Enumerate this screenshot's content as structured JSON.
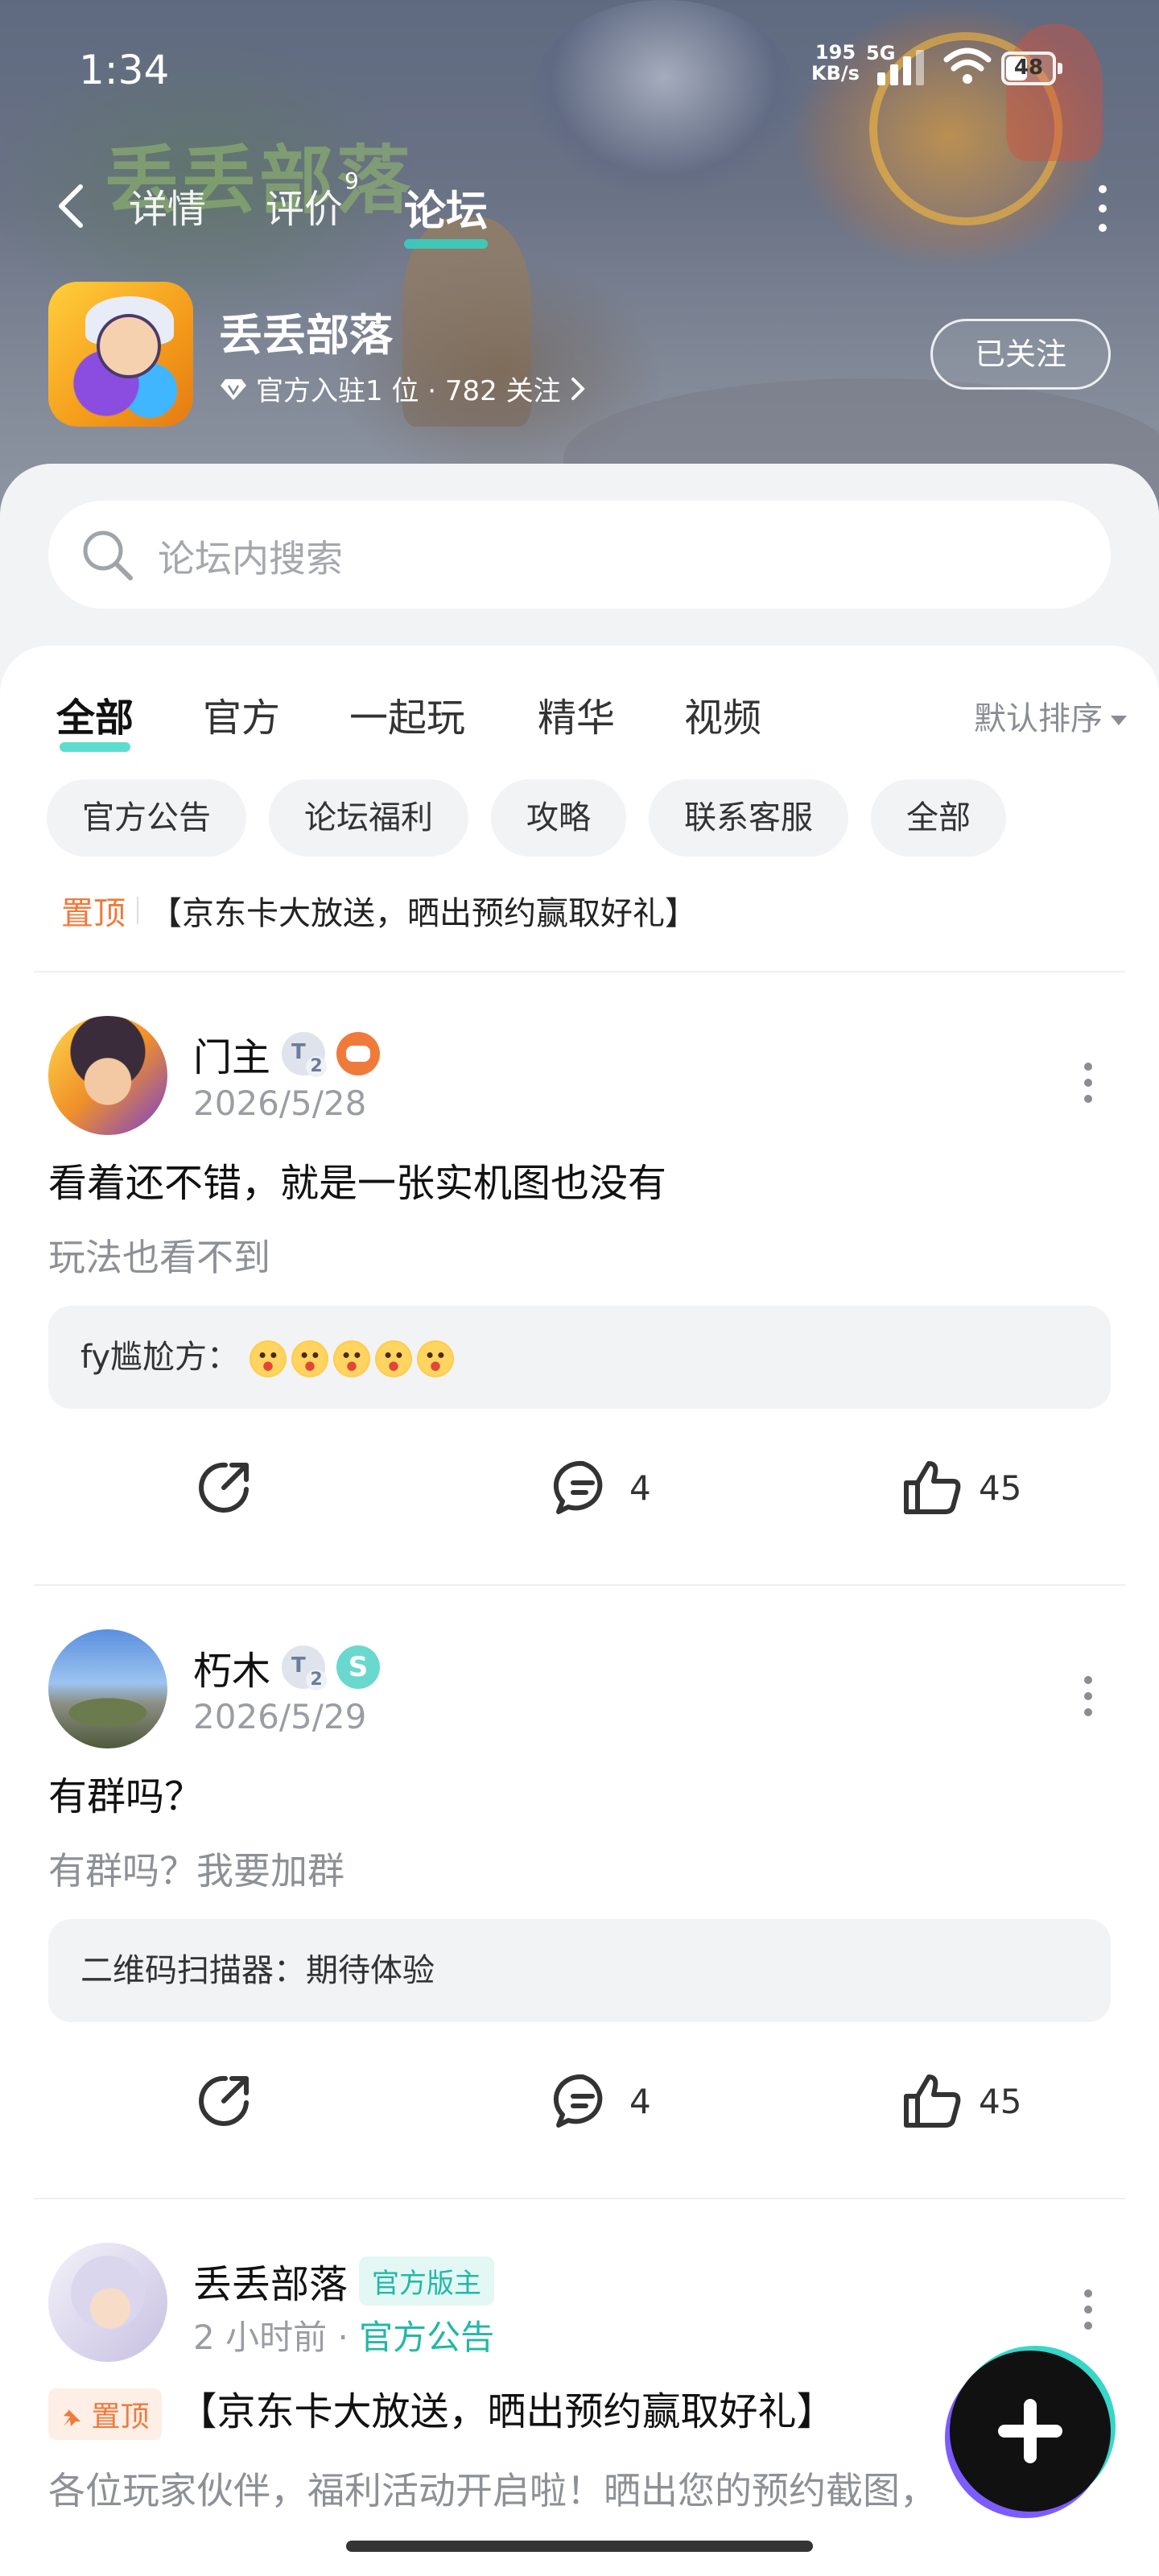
{
  "status_bar": {
    "time": "1:34",
    "net_speed": "195",
    "net_unit": "KB/s",
    "network": "5G",
    "battery": "48"
  },
  "nav": {
    "tabs": [
      {
        "label": "详情"
      },
      {
        "label": "评价"
      },
      {
        "label": "论坛"
      }
    ],
    "review_badge": "9",
    "active_tab": "论坛"
  },
  "game": {
    "name": "丢丢部落",
    "meta": "官方入驻1 位 · 782 关注",
    "follow_label": "已关注"
  },
  "search": {
    "placeholder": "论坛内搜索"
  },
  "filter_tabs": [
    {
      "label": "全部"
    },
    {
      "label": "官方"
    },
    {
      "label": "一起玩"
    },
    {
      "label": "精华"
    },
    {
      "label": "视频"
    }
  ],
  "sort_label": "默认排序",
  "chips": [
    "官方公告",
    "论坛福利",
    "攻略",
    "联系客服",
    "全部"
  ],
  "pinned_bar": {
    "tag": "置顶",
    "text": "【京东卡大放送，晒出预约赢取好礼】"
  },
  "posts": [
    {
      "user": "门主",
      "level": "2",
      "date": "2026/5/28",
      "title": "看着还不错，就是一张实机图也没有",
      "body": "玩法也看不到",
      "comment_user": "fy尴尬方：",
      "comments": "4",
      "likes": "45"
    },
    {
      "user": "朽木",
      "level": "2",
      "date": "2026/5/29",
      "title": "有群吗？",
      "body": "有群吗？我要加群",
      "comment_user": "二维码扫描器：期待体验",
      "comments": "4",
      "likes": "45"
    },
    {
      "user": "丢丢部落",
      "role": "官方版主",
      "time": "2 小时前",
      "category": "官方公告",
      "pinned_tag": "置顶",
      "title": "【京东卡大放送，晒出预约赢取好礼】",
      "body": "各位玩家伙伴，福利活动开启啦！晒出您的预约截图，"
    }
  ],
  "logo_text": "丢丢部落",
  "colors": {
    "accent": "#35d4c4",
    "pinned": "#f07a3a",
    "official": "#22b8a7"
  }
}
